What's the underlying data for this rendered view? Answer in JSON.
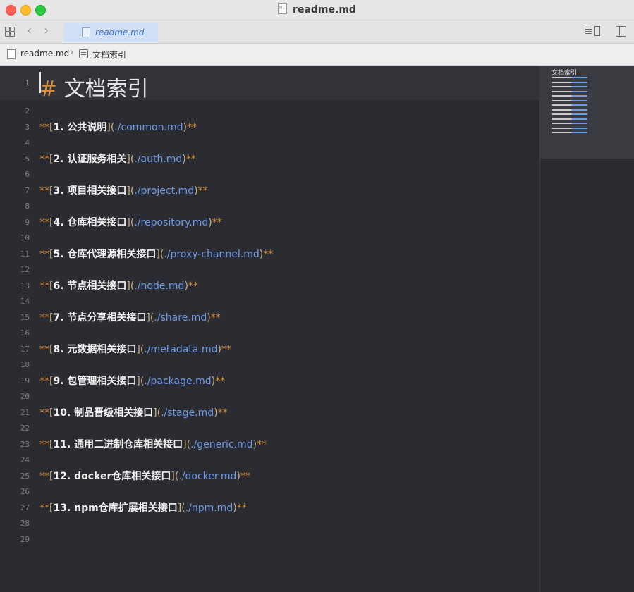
{
  "window": {
    "title": "readme.md"
  },
  "tabs": [
    {
      "label": "readme.md",
      "active": true
    }
  ],
  "breadcrumb": {
    "file": "readme.md",
    "section": "文档索引"
  },
  "icons": {
    "traffic": [
      "close-window-icon",
      "minimize-window-icon",
      "zoom-window-icon"
    ],
    "toolbar": [
      "grid-icon",
      "back-arrow-icon",
      "forward-arrow-icon",
      "outline-toggle-icon",
      "split-pane-icon"
    ],
    "file": "markdown-file-icon",
    "section": "list-icon"
  },
  "colors": {
    "background": "#2a2c31",
    "markup": "#d98c3a",
    "link": "#6f9ae8",
    "text": "#f2f2f2",
    "tab_active": "#d2e0f5"
  },
  "editor": {
    "heading": {
      "number": "1",
      "hash": "#",
      "text": "文档索引"
    },
    "line_numbers": [
      "2",
      "3",
      "4",
      "5",
      "6",
      "7",
      "8",
      "9",
      "10",
      "11",
      "12",
      "13",
      "14",
      "15",
      "16",
      "17",
      "18",
      "19",
      "20",
      "21",
      "22",
      "23",
      "24",
      "25",
      "26",
      "27",
      "28",
      "29"
    ],
    "links": [
      {
        "line": "3",
        "text": "1. 公共说明",
        "url": "./common.md"
      },
      {
        "line": "5",
        "text": "2. 认证服务相关",
        "url": "./auth.md"
      },
      {
        "line": "7",
        "text": "3. 项目相关接口",
        "url": "./project.md"
      },
      {
        "line": "9",
        "text": "4. 仓库相关接口",
        "url": "./repository.md"
      },
      {
        "line": "11",
        "text": "5. 仓库代理源相关接口",
        "url": "./proxy-channel.md"
      },
      {
        "line": "13",
        "text": "6. 节点相关接口",
        "url": "./node.md"
      },
      {
        "line": "15",
        "text": "7. 节点分享相关接口",
        "url": "./share.md"
      },
      {
        "line": "17",
        "text": "8. 元数据相关接口",
        "url": "./metadata.md"
      },
      {
        "line": "19",
        "text": "9. 包管理相关接口",
        "url": "./package.md"
      },
      {
        "line": "21",
        "text": "10. 制品晋级相关接口",
        "url": "./stage.md"
      },
      {
        "line": "23",
        "text": "11. 通用二进制仓库相关接口",
        "url": "./generic.md"
      },
      {
        "line": "25",
        "text": "12. docker仓库相关接口",
        "url": "./docker.md"
      },
      {
        "line": "27",
        "text": "13. npm仓库扩展相关接口",
        "url": "./npm.md"
      }
    ]
  },
  "minimap": {
    "title": "文档索引"
  }
}
